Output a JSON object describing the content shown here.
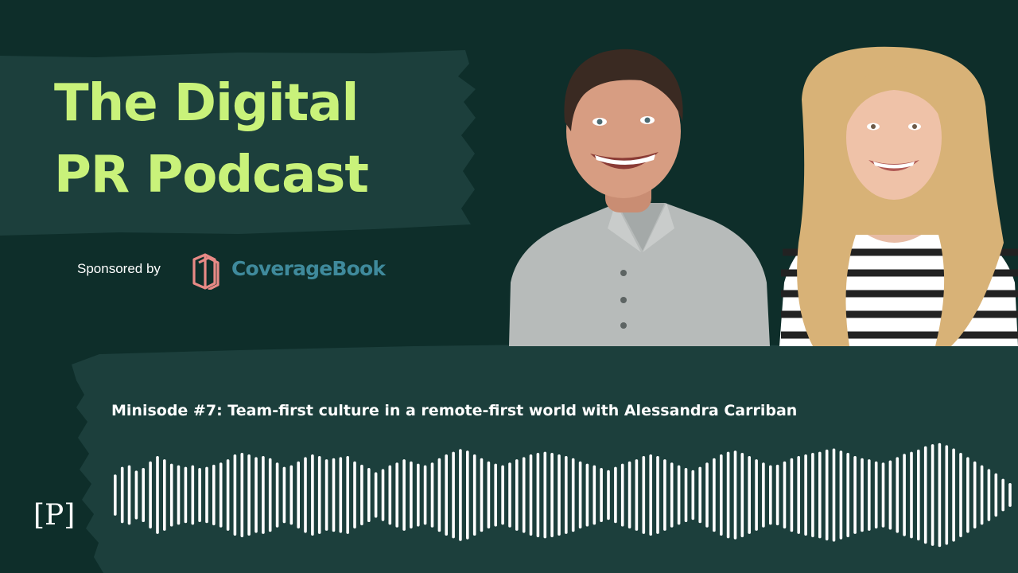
{
  "podcast": {
    "title_line1": "The Digital",
    "title_line2": "PR Podcast"
  },
  "sponsor": {
    "label": "Sponsored by",
    "name": "CoverageBook",
    "logo_icon": "coveragebook-book-icon"
  },
  "episode": {
    "title": "Minisode #7: Team-first culture in a remote-first world with Alessandra Carriban"
  },
  "brand_mark": "[P]",
  "photo": {
    "description_icon": "hosts-photo"
  },
  "waveform": {
    "levels": [
      0.38,
      0.52,
      0.55,
      0.45,
      0.5,
      0.62,
      0.72,
      0.66,
      0.58,
      0.55,
      0.52,
      0.55,
      0.5,
      0.52,
      0.56,
      0.6,
      0.66,
      0.75,
      0.78,
      0.75,
      0.7,
      0.72,
      0.68,
      0.6,
      0.52,
      0.55,
      0.62,
      0.7,
      0.75,
      0.72,
      0.66,
      0.68,
      0.7,
      0.72,
      0.62,
      0.56,
      0.5,
      0.42,
      0.48,
      0.55,
      0.6,
      0.66,
      0.62,
      0.58,
      0.55,
      0.6,
      0.68,
      0.75,
      0.8,
      0.85,
      0.82,
      0.75,
      0.68,
      0.62,
      0.58,
      0.55,
      0.6,
      0.66,
      0.7,
      0.75,
      0.78,
      0.8,
      0.78,
      0.75,
      0.72,
      0.68,
      0.62,
      0.58,
      0.55,
      0.5,
      0.46,
      0.52,
      0.58,
      0.62,
      0.66,
      0.72,
      0.75,
      0.72,
      0.66,
      0.6,
      0.55,
      0.5,
      0.46,
      0.52,
      0.6,
      0.68,
      0.75,
      0.8,
      0.82,
      0.78,
      0.72,
      0.66,
      0.6,
      0.55,
      0.56,
      0.62,
      0.68,
      0.72,
      0.75,
      0.78,
      0.8,
      0.84,
      0.86,
      0.82,
      0.78,
      0.72,
      0.68,
      0.66,
      0.62,
      0.6,
      0.64,
      0.7,
      0.76,
      0.8,
      0.84,
      0.9,
      0.94,
      0.96,
      0.92,
      0.86,
      0.78,
      0.7,
      0.62,
      0.55,
      0.48,
      0.4,
      0.3,
      0.22
    ]
  },
  "colors": {
    "background": "#0e2e2a",
    "panel": "#1c3f3c",
    "title": "#c9f27a",
    "sponsor_accent": "#3f8a9c",
    "logo_pink": "#e88a86"
  }
}
